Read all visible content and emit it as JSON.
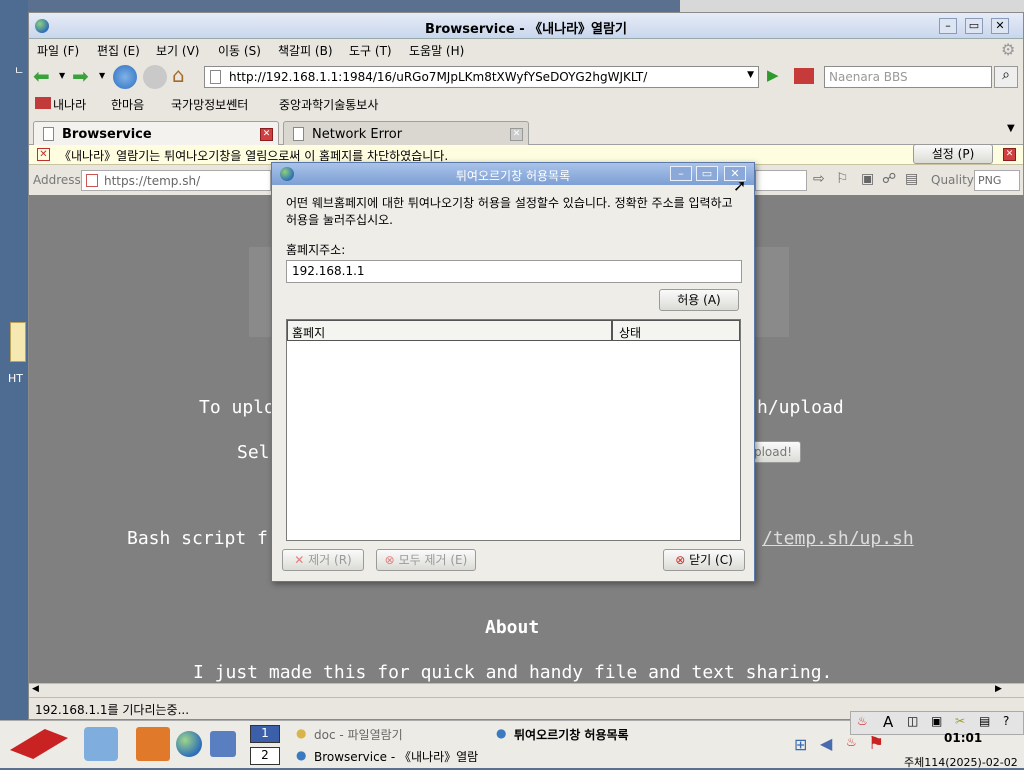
{
  "desktop": {
    "left_label": "HT",
    "top_glyph": "ㄴ"
  },
  "window": {
    "title": "Browservice - 《내나라》열람기"
  },
  "menu": [
    "파일 (F)",
    "편집 (E)",
    "보기 (V)",
    "이동 (S)",
    "책갈피 (B)",
    "도구 (T)",
    "도움말 (H)"
  ],
  "nav": {
    "url": "http://192.168.1.1:1984/16/uRGo7MJpLKm8tXWyfYSeDOYG2hgWJKLT/",
    "search_placeholder": "Naenara BBS"
  },
  "bookmarks": [
    "내나라",
    "한마음",
    "국가망정보쎈터",
    "중앙과학기술통보사"
  ],
  "tabs": [
    {
      "label": "Browservice",
      "active": true
    },
    {
      "label": "Network Error",
      "active": false
    }
  ],
  "notification": {
    "text": "《내나라》열람기는 튀여나오기창을 열림으로써 이 홈페지를 차단하였습니다.",
    "settings_label": "설정 (P)"
  },
  "address": {
    "label": "Address",
    "value": "https://temp.sh/",
    "quality_label": "Quality",
    "quality_value": "PNG"
  },
  "page": {
    "line1_left": "To uplo",
    "line1_right": "h/upload",
    "line2_left": "Sel",
    "upload_button": "pload!",
    "line3_left": "Bash script f",
    "line3_right": "/temp.sh/up.sh",
    "about_heading": "About",
    "about_text": "I just made this for quick and handy file and text sharing."
  },
  "status": {
    "text": "192.168.1.1를 기다리는중..."
  },
  "dialog": {
    "title": "튀여오르기창 허용목록",
    "description": "어떤 웨브홈페지에 대한 튀여나오기창 허용을 설정할수 있습니다. 정확한 주소를 입력하고 허용을 눌러주십시오.",
    "address_label": "홈페지주소:",
    "address_value": "192.168.1.1",
    "allow_button": "허용 (A)",
    "col_site": "홈페지",
    "col_status": "상태",
    "remove_button": "제거 (R)",
    "remove_all_button": "모두 제거 (E)",
    "close_button": "닫기 (C)"
  },
  "taskbar": {
    "workspaces": [
      "1",
      "2"
    ],
    "items": [
      "doc - 파일열람기",
      "튀여오르기창 허용목록",
      "Browservice - 《내나라》열람"
    ],
    "time": "01:01",
    "date": "주체114(2025)-02-02"
  },
  "colors": {
    "content_bg": "#808080",
    "dialog_title": "#7d9fd4",
    "desktop": "#5b6f8e"
  }
}
